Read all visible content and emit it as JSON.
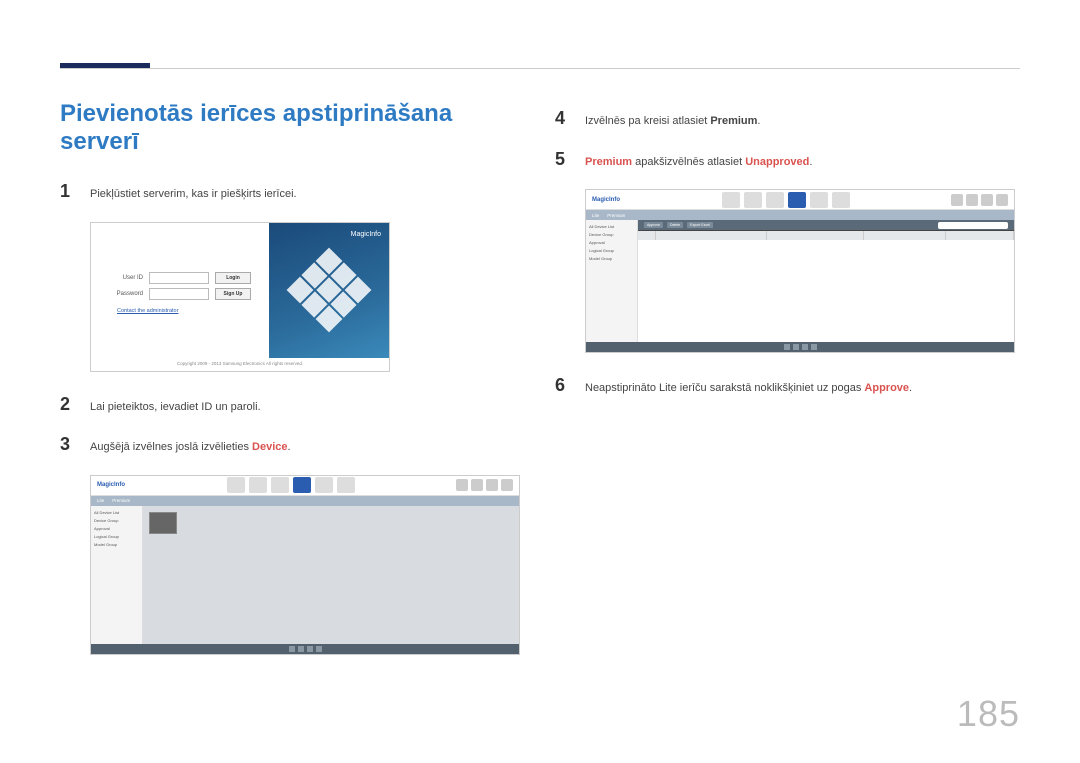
{
  "page_number": "185",
  "title": "Pievienotās ierīces apstiprināšana serverī",
  "steps": {
    "s1": {
      "num": "1",
      "text": "Piekļūstiet serverim, kas ir piešķirts ierīcei."
    },
    "s2": {
      "num": "2",
      "text": "Lai pieteiktos, ievadiet ID un paroli."
    },
    "s3": {
      "num": "3",
      "pre": "Augšējā izvēlnes joslā izvēlieties ",
      "kw": "Device",
      "post": "."
    },
    "s4": {
      "num": "4",
      "pre": "Izvēlnēs pa kreisi atlasiet ",
      "kw": "Premium",
      "post": "."
    },
    "s5": {
      "num": "5",
      "kw1": "Premium",
      "mid": " apakšizvēlnēs atlasiet ",
      "kw2": "Unapproved",
      "post": "."
    },
    "s6": {
      "num": "6",
      "pre": "Neapstiprināto Lite ierīču sarakstā noklikšķiniet uz pogas ",
      "kw": "Approve",
      "post": "."
    }
  },
  "login": {
    "brand": "MagicInfo",
    "user_label": "User ID",
    "pass_label": "Password",
    "login_btn": "Login",
    "signup_btn": "Sign Up",
    "contact": "Contact the administrator",
    "copyright": "Copyright 2009 - 2013 Samsung Electronics All rights reserved."
  },
  "app": {
    "brand": "MagicInfo",
    "tabs": [
      "Lite",
      "Premium"
    ],
    "side_items": [
      "All Device List",
      "Device Group",
      "Approval",
      "Logical Group",
      "Model Group"
    ],
    "toolbar_buttons": [
      "Approve",
      "Delete",
      "Export Excel"
    ]
  }
}
